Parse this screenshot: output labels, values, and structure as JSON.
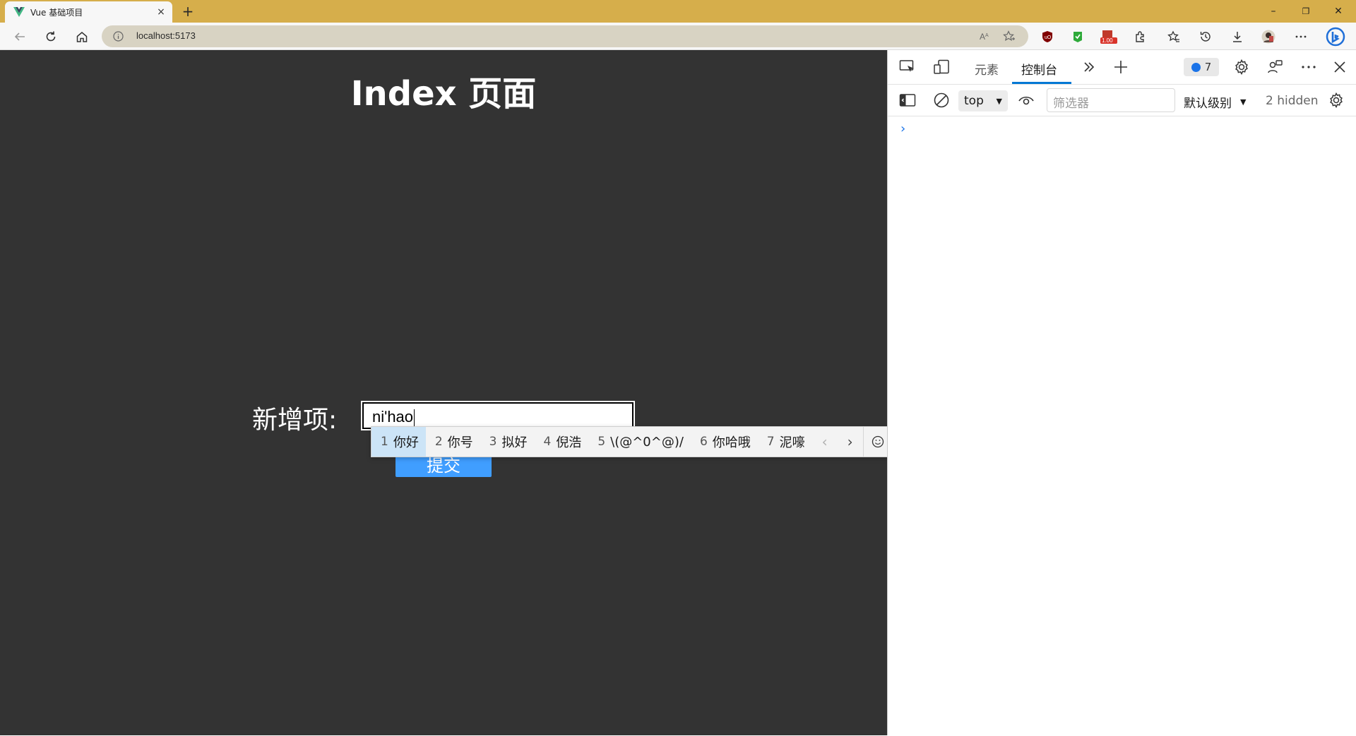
{
  "browser": {
    "tab_title": "Vue 基础项目",
    "tab_close": "×",
    "new_tab": "+",
    "url": "localhost:5173",
    "window_controls": {
      "minimize": "–",
      "restore": "❐",
      "close": "✕"
    },
    "extension_badge": "1.00"
  },
  "page": {
    "title": "Index 页面",
    "field_label": "新增项:",
    "input_value": "ni'hao",
    "submit_label": "提交"
  },
  "ime": {
    "candidates": [
      {
        "num": "1",
        "text": "你好",
        "selected": true
      },
      {
        "num": "2",
        "text": "你号"
      },
      {
        "num": "3",
        "text": "拟好"
      },
      {
        "num": "4",
        "text": "倪浩"
      },
      {
        "num": "5",
        "text": "\\(@^0^@)/"
      },
      {
        "num": "6",
        "text": "你哈哦"
      },
      {
        "num": "7",
        "text": "泥嚎"
      }
    ],
    "prev": "‹",
    "next": "›"
  },
  "devtools": {
    "tabs": {
      "elements": "元素",
      "console": "控制台"
    },
    "issues_count": "7",
    "context": "top",
    "filter_placeholder": "筛选器",
    "levels": "默认级别",
    "hidden": "2 hidden",
    "prompt": "›",
    "accent": "#0078d4"
  },
  "colors": {
    "titlebar": "#d6ae4b",
    "page_bg": "#333333",
    "submit_bg": "#409eff",
    "ime_selected": "#cce4f7"
  }
}
